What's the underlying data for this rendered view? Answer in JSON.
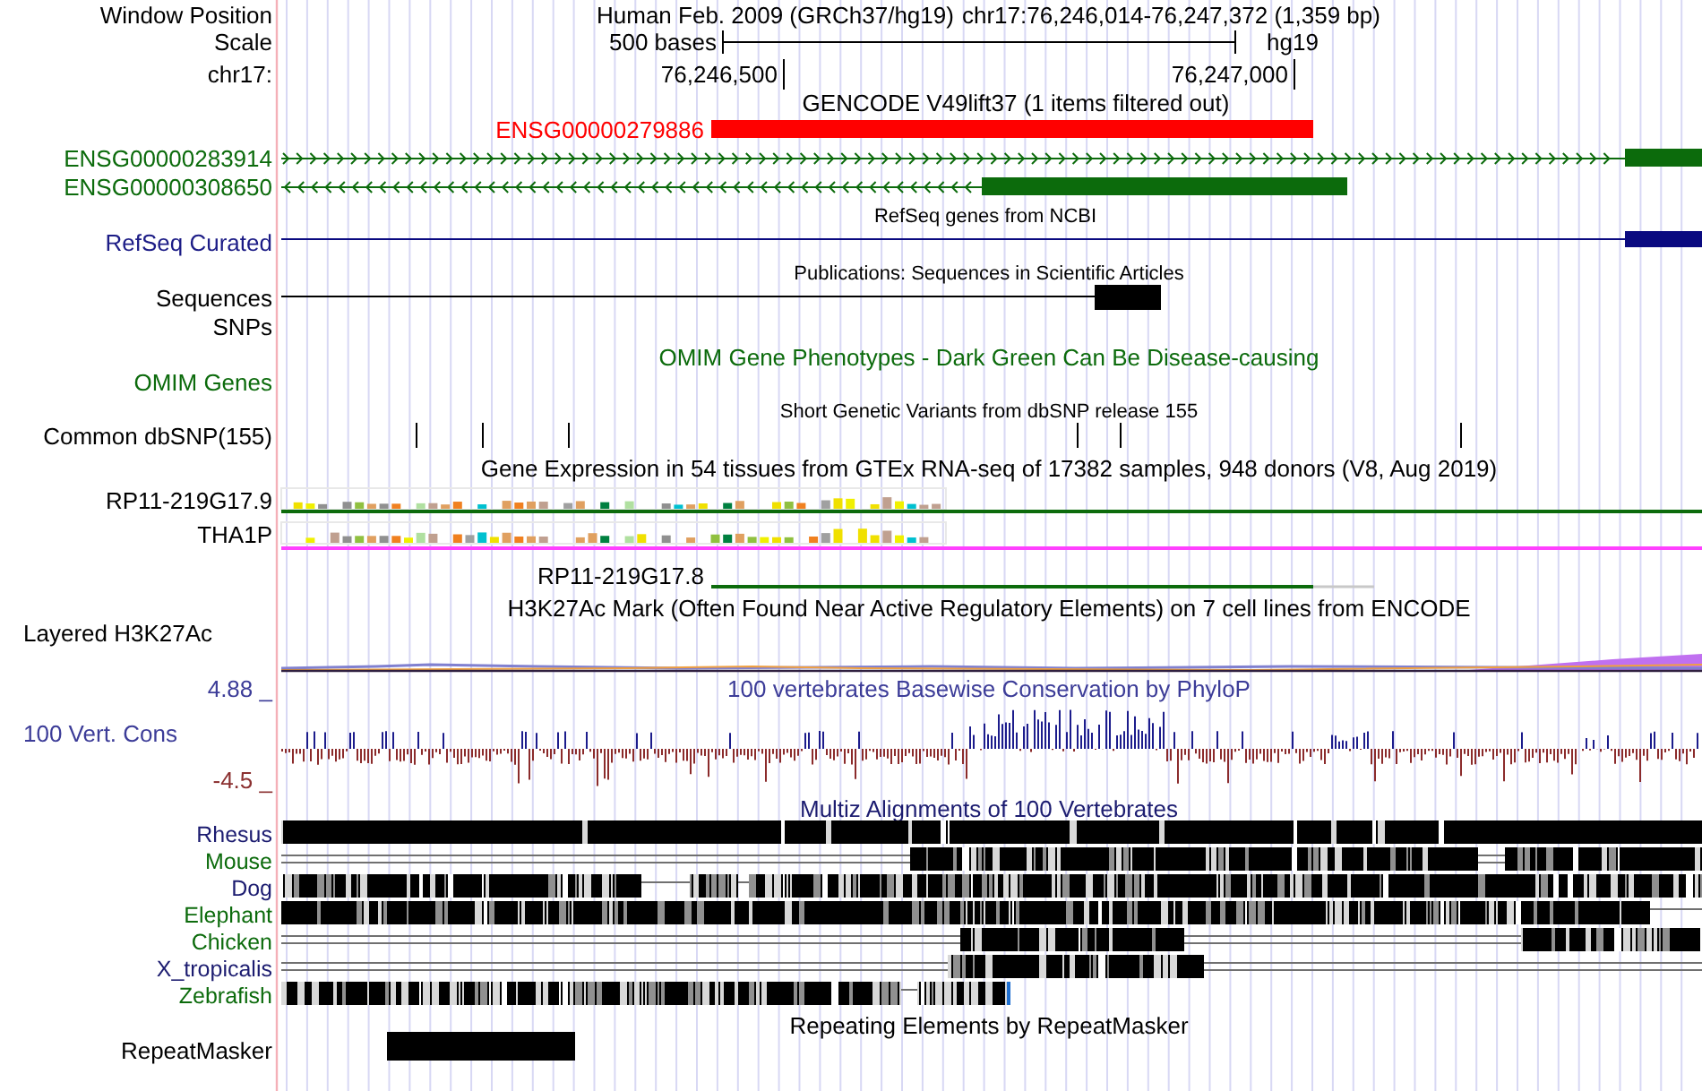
{
  "browser_header": {
    "assembly": "Human Feb. 2009 (GRCh37/hg19)",
    "position": "chr17:76,246,014-76,247,372 (1,359 bp)"
  },
  "scale_bar": {
    "length": "500 bases",
    "assembly": "hg19"
  },
  "ruler": {
    "ticks": [
      "76,246,500",
      "76,247,000"
    ]
  },
  "track_labels": [
    {
      "text": "Window Position",
      "color": "#000000"
    },
    {
      "text": "Scale",
      "color": "#000000"
    },
    {
      "text": "chr17:",
      "color": "#000000"
    },
    {
      "text": "ENSG00000283914",
      "color": "#0c6b0c"
    },
    {
      "text": "ENSG00000308650",
      "color": "#0c6b0c"
    },
    {
      "text": "RefSeq Curated",
      "color": "#1c1c86"
    },
    {
      "text": "Sequences",
      "color": "#000000"
    },
    {
      "text": "SNPs",
      "color": "#000000"
    },
    {
      "text": "OMIM Genes",
      "color": "#0c6b0c"
    },
    {
      "text": "Common dbSNP(155)",
      "color": "#000000"
    },
    {
      "text": "RP11-219G17.9",
      "color": "#000000"
    },
    {
      "text": "THA1P",
      "color": "#000000"
    },
    {
      "text": "Layered H3K27Ac",
      "color": "#000000"
    },
    {
      "text": "4.88 _",
      "color": "#3c3c98"
    },
    {
      "text": "100 Vert. Cons",
      "color": "#3c3c98"
    },
    {
      "text": "-4.5 _",
      "color": "#8b3030"
    },
    {
      "text": "Rhesus",
      "color": "#1c1c70"
    },
    {
      "text": "Mouse",
      "color": "#0c6b0c"
    },
    {
      "text": "Dog",
      "color": "#1c1c70"
    },
    {
      "text": "Elephant",
      "color": "#0c6b0c"
    },
    {
      "text": "Chicken",
      "color": "#0c6b0c"
    },
    {
      "text": "X_tropicalis",
      "color": "#1c1c70"
    },
    {
      "text": "Zebrafish",
      "color": "#0c6b0c"
    },
    {
      "text": "RepeatMasker",
      "color": "#000000"
    }
  ],
  "track_titles": [
    {
      "text": "GENCODE V49lift37 (1 items filtered out)",
      "color": "#000000"
    },
    {
      "text": "RefSeq genes from NCBI",
      "color": "#000000"
    },
    {
      "text": "Publications: Sequences in Scientific Articles",
      "color": "#000000"
    },
    {
      "text": "OMIM Gene Phenotypes - Dark Green Can Be Disease-causing",
      "color": "#0c6b0c"
    },
    {
      "text": "Short Genetic Variants from dbSNP release 155",
      "color": "#000000"
    },
    {
      "text": "Gene Expression in 54 tissues from GTEx RNA-seq of 17382 samples, 948 donors (V8, Aug 2019)",
      "color": "#000000"
    },
    {
      "text": "H3K27Ac Mark (Often Found Near Active Regulatory Elements) on 7 cell lines from ENCODE",
      "color": "#000000"
    },
    {
      "text": "100 vertebrates Basewise Conservation by PhyloP",
      "color": "#3c3c98"
    },
    {
      "text": "Multiz Alignments of 100 Vertebrates",
      "color": "#1c1c70"
    },
    {
      "text": "Repeating Elements by RepeatMasker",
      "color": "#000000"
    }
  ],
  "feature_labels": [
    {
      "text": "ENSG00000279886",
      "color": "#ff0000"
    },
    {
      "text": "RP11-219G17.8",
      "color": "#000000"
    }
  ]
}
